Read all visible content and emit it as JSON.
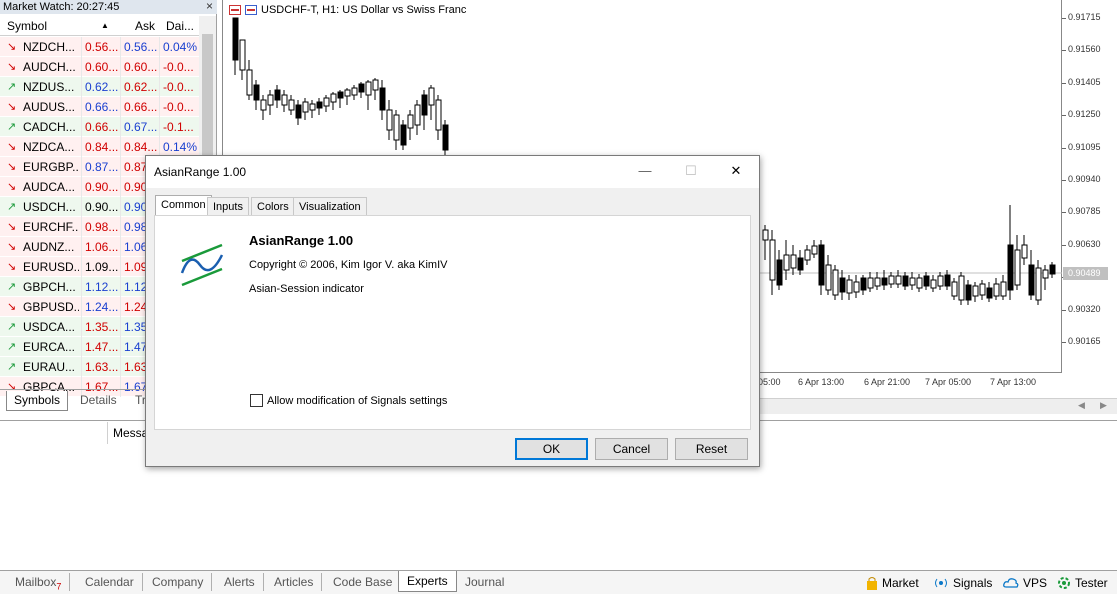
{
  "market_watch": {
    "title": "Market Watch: 20:27:45",
    "close_glyph": "×",
    "columns": {
      "symbol": "Symbol",
      "sort": "▲",
      "ask": "Ask",
      "daily": "Dai..."
    },
    "rows": [
      {
        "symbol": "NZDCH...",
        "bid": "0.56...",
        "ask": "0.56...",
        "daily": "0.04%",
        "dir": "down",
        "bid_color": "#d00000",
        "ask_color": "#1a3fd0",
        "daily_color": "#1a3fd0",
        "bg": "#fff0f0"
      },
      {
        "symbol": "AUDCH...",
        "bid": "0.60...",
        "ask": "0.60...",
        "daily": "-0.0...",
        "dir": "down",
        "bid_color": "#d00000",
        "ask_color": "#d00000",
        "daily_color": "#d00000",
        "bg": "#fff0f0"
      },
      {
        "symbol": "NZDUS...",
        "bid": "0.62...",
        "ask": "0.62...",
        "daily": "-0.0...",
        "dir": "up",
        "bid_color": "#1a3fd0",
        "ask_color": "#d00000",
        "daily_color": "#d00000",
        "bg": "#eef8ee"
      },
      {
        "symbol": "AUDUS...",
        "bid": "0.66...",
        "ask": "0.66...",
        "daily": "-0.0...",
        "dir": "down",
        "bid_color": "#1a3fd0",
        "ask_color": "#d00000",
        "daily_color": "#d00000",
        "bg": "#fff0f0"
      },
      {
        "symbol": "CADCH...",
        "bid": "0.66...",
        "ask": "0.67...",
        "daily": "-0.1...",
        "dir": "up",
        "bid_color": "#d00000",
        "ask_color": "#1a3fd0",
        "daily_color": "#d00000",
        "bg": "#eef8ee"
      },
      {
        "symbol": "NZDCA...",
        "bid": "0.84...",
        "ask": "0.84...",
        "daily": "0.14%",
        "dir": "down",
        "bid_color": "#d00000",
        "ask_color": "#d00000",
        "daily_color": "#1a3fd0",
        "bg": "#fff0f0"
      },
      {
        "symbol": "EURGBP...",
        "bid": "0.87...",
        "ask": "0.87",
        "daily": "",
        "dir": "down",
        "bid_color": "#1a3fd0",
        "ask_color": "#d00000",
        "daily_color": "#000000",
        "bg": "#fff0f0"
      },
      {
        "symbol": "AUDCA...",
        "bid": "0.90...",
        "ask": "0.90",
        "daily": "",
        "dir": "down",
        "bid_color": "#d00000",
        "ask_color": "#d00000",
        "daily_color": "#000000",
        "bg": "#fff0f0"
      },
      {
        "symbol": "USDCH...",
        "bid": "0.90...",
        "ask": "0.90",
        "daily": "",
        "dir": "up",
        "bid_color": "#000000",
        "ask_color": "#1a3fd0",
        "daily_color": "#000000",
        "bg": "#eef8ee"
      },
      {
        "symbol": "EURCHF...",
        "bid": "0.98...",
        "ask": "0.98",
        "daily": "",
        "dir": "down",
        "bid_color": "#d00000",
        "ask_color": "#1a3fd0",
        "daily_color": "#000000",
        "bg": "#fff0f0"
      },
      {
        "symbol": "AUDNZ...",
        "bid": "1.06...",
        "ask": "1.06",
        "daily": "",
        "dir": "down",
        "bid_color": "#d00000",
        "ask_color": "#1a3fd0",
        "daily_color": "#000000",
        "bg": "#fff0f0"
      },
      {
        "symbol": "EURUSD...",
        "bid": "1.09...",
        "ask": "1.09",
        "daily": "",
        "dir": "down",
        "bid_color": "#000000",
        "ask_color": "#d00000",
        "daily_color": "#000000",
        "bg": "#fff0f0"
      },
      {
        "symbol": "GBPCH...",
        "bid": "1.12...",
        "ask": "1.12",
        "daily": "",
        "dir": "up",
        "bid_color": "#1a3fd0",
        "ask_color": "#1a3fd0",
        "daily_color": "#000000",
        "bg": "#eef8ee"
      },
      {
        "symbol": "GBPUSD...",
        "bid": "1.24...",
        "ask": "1.24",
        "daily": "",
        "dir": "down",
        "bid_color": "#1a3fd0",
        "ask_color": "#d00000",
        "daily_color": "#000000",
        "bg": "#fff0f0"
      },
      {
        "symbol": "USDCA...",
        "bid": "1.35...",
        "ask": "1.35",
        "daily": "",
        "dir": "up",
        "bid_color": "#d00000",
        "ask_color": "#1a3fd0",
        "daily_color": "#000000",
        "bg": "#eef8ee"
      },
      {
        "symbol": "EURCA...",
        "bid": "1.47...",
        "ask": "1.47",
        "daily": "",
        "dir": "up",
        "bid_color": "#d00000",
        "ask_color": "#1a3fd0",
        "daily_color": "#000000",
        "bg": "#eef8ee"
      },
      {
        "symbol": "EURAU...",
        "bid": "1.63...",
        "ask": "1.63",
        "daily": "",
        "dir": "up",
        "bid_color": "#d00000",
        "ask_color": "#d00000",
        "daily_color": "#000000",
        "bg": "#eef8ee"
      },
      {
        "symbol": "GBPCA...",
        "bid": "1.67...",
        "ask": "1.67",
        "daily": "",
        "dir": "down",
        "bid_color": "#d00000",
        "ask_color": "#1a3fd0",
        "daily_color": "#000000",
        "bg": "#fff0f0"
      }
    ],
    "tabs": [
      "Symbols",
      "Details",
      "Tr"
    ]
  },
  "chart": {
    "title": "USDCHF-T, H1:  US Dollar vs Swiss Franc",
    "prices": [
      "0.91715",
      "0.91560",
      "0.91405",
      "0.91250",
      "0.91095",
      "0.90940",
      "0.90785",
      "0.90630",
      "0.90475",
      "0.90320",
      "0.90165"
    ],
    "current_price": "0.90489",
    "times": [
      "05:00",
      "6 Apr 13:00",
      "6 Apr 21:00",
      "7 Apr 05:00",
      "7 Apr 13:00"
    ],
    "scroll_left": "◀",
    "scroll_right": "▶"
  },
  "toolbox": {
    "message_header": "Messa",
    "tabs": [
      {
        "label": "Mailbox",
        "badge": "7"
      },
      {
        "label": "Calendar",
        "badge": ""
      },
      {
        "label": "Company",
        "badge": ""
      },
      {
        "label": "Alerts",
        "badge": ""
      },
      {
        "label": "Articles",
        "badge": ""
      },
      {
        "label": "Code Base",
        "badge": ""
      },
      {
        "label": "Experts",
        "badge": ""
      },
      {
        "label": "Journal",
        "badge": ""
      }
    ],
    "active_tab": "Experts",
    "status": [
      {
        "label": "Market",
        "icon": "bag-icon",
        "color": "#f2b400"
      },
      {
        "label": "Signals",
        "icon": "signal-icon",
        "color": "#0a78c8"
      },
      {
        "label": "VPS",
        "icon": "cloud-icon",
        "color": "#0a78c8"
      },
      {
        "label": "Tester",
        "icon": "tester-icon",
        "color": "#1a9a3a"
      }
    ]
  },
  "dialog": {
    "title": "AsianRange 1.00",
    "window_buttons": {
      "minimize": "—",
      "maximize": "☐",
      "close": "✕"
    },
    "tabs": [
      "Common",
      "Inputs",
      "Colors",
      "Visualization"
    ],
    "active_tab": "Common",
    "name": "AsianRange 1.00",
    "copyright": "Copyright © 2006, Kim Igor V. aka KimIV",
    "description": "Asian-Session indicator",
    "allow_label": "Allow modification of Signals settings",
    "buttons": {
      "ok": "OK",
      "cancel": "Cancel",
      "reset": "Reset"
    }
  },
  "colors": {
    "bid_up": "#1a3fd0",
    "bid_down": "#d00000",
    "arrow_up": "#1a9a3a",
    "arrow_down": "#d00000",
    "dialog_accent": "#0078d7"
  }
}
